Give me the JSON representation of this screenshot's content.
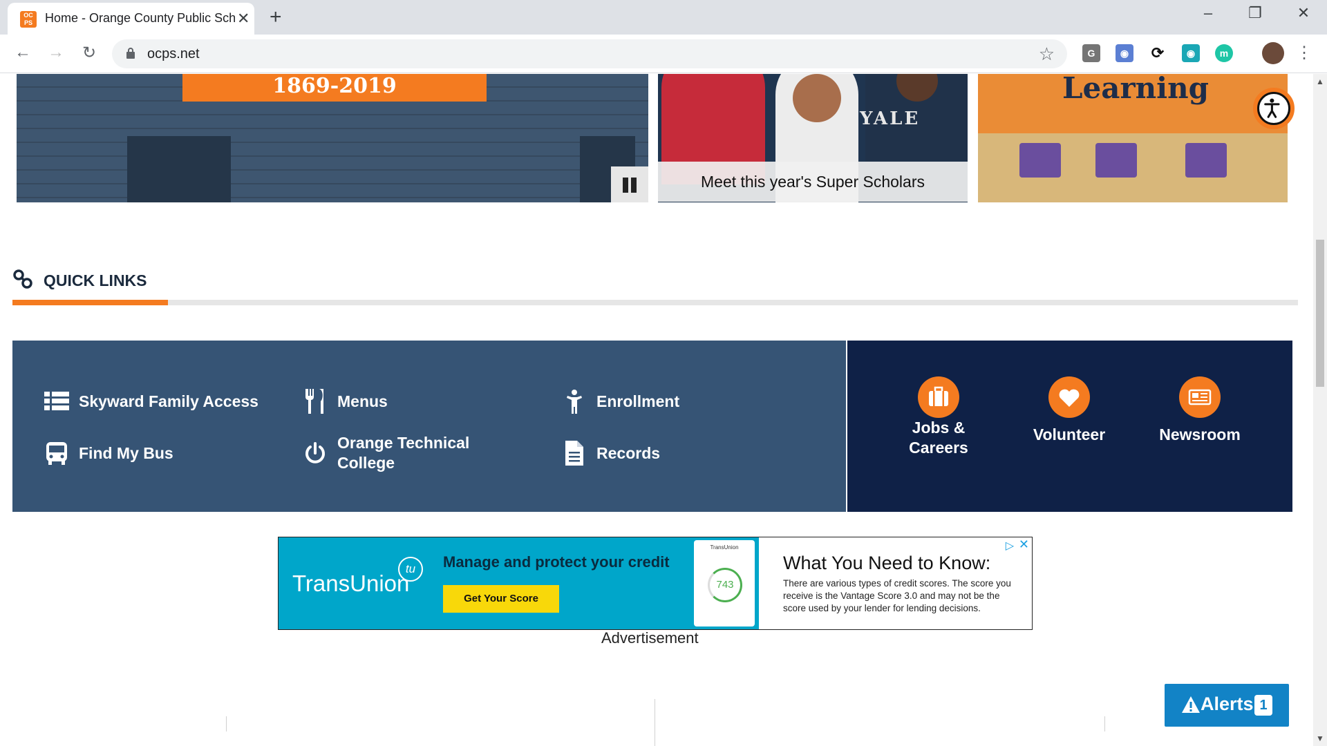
{
  "browser": {
    "tab_title": "Home - Orange County Public Schools",
    "tab_favicon_text": "OC PS",
    "close_tab": "✕",
    "new_tab": "+",
    "url": "ocps.net",
    "extensions": [
      "G",
      "m"
    ]
  },
  "hero": {
    "slide1_banner": "1869-2019",
    "slide2_caption": "Meet this year's Super Scholars",
    "slide2_shirt_text": "YALE",
    "slide3_word": "Learning"
  },
  "quick_links": {
    "title": "QUICK LINKS",
    "left_items": [
      {
        "label": "Skyward Family Access",
        "icon": "list-icon"
      },
      {
        "label": "Menus",
        "icon": "utensils-icon"
      },
      {
        "label": "Enrollment",
        "icon": "child-icon"
      },
      {
        "label": "Find My Bus",
        "icon": "bus-icon"
      },
      {
        "label": "Orange Technical College",
        "icon": "power-icon"
      },
      {
        "label": "Records",
        "icon": "document-icon"
      }
    ],
    "right_items": [
      {
        "label": "Jobs & Careers",
        "icon": "briefcase-icon"
      },
      {
        "label": "Volunteer",
        "icon": "heart-icon"
      },
      {
        "label": "Newsroom",
        "icon": "newspaper-icon"
      }
    ]
  },
  "ad": {
    "brand": "TransUnion",
    "logo": "tu",
    "headline": "Manage and protect your credit",
    "cta": "Get Your Score",
    "phone_brand": "TransUnion",
    "score": "743",
    "right_title": "What You Need to Know:",
    "right_body": "There are various types of credit scores. The score you receive is the Vantage Score 3.0 and may not be the score used by your lender for lending decisions.",
    "label": "Advertisement"
  },
  "alerts": {
    "label": "Alerts",
    "count": "1"
  },
  "colors": {
    "brand_orange": "#f47b20",
    "quicklinks_blue": "#365475",
    "quicklinks_navy": "#0f2147",
    "alerts_blue": "#1283c6"
  }
}
